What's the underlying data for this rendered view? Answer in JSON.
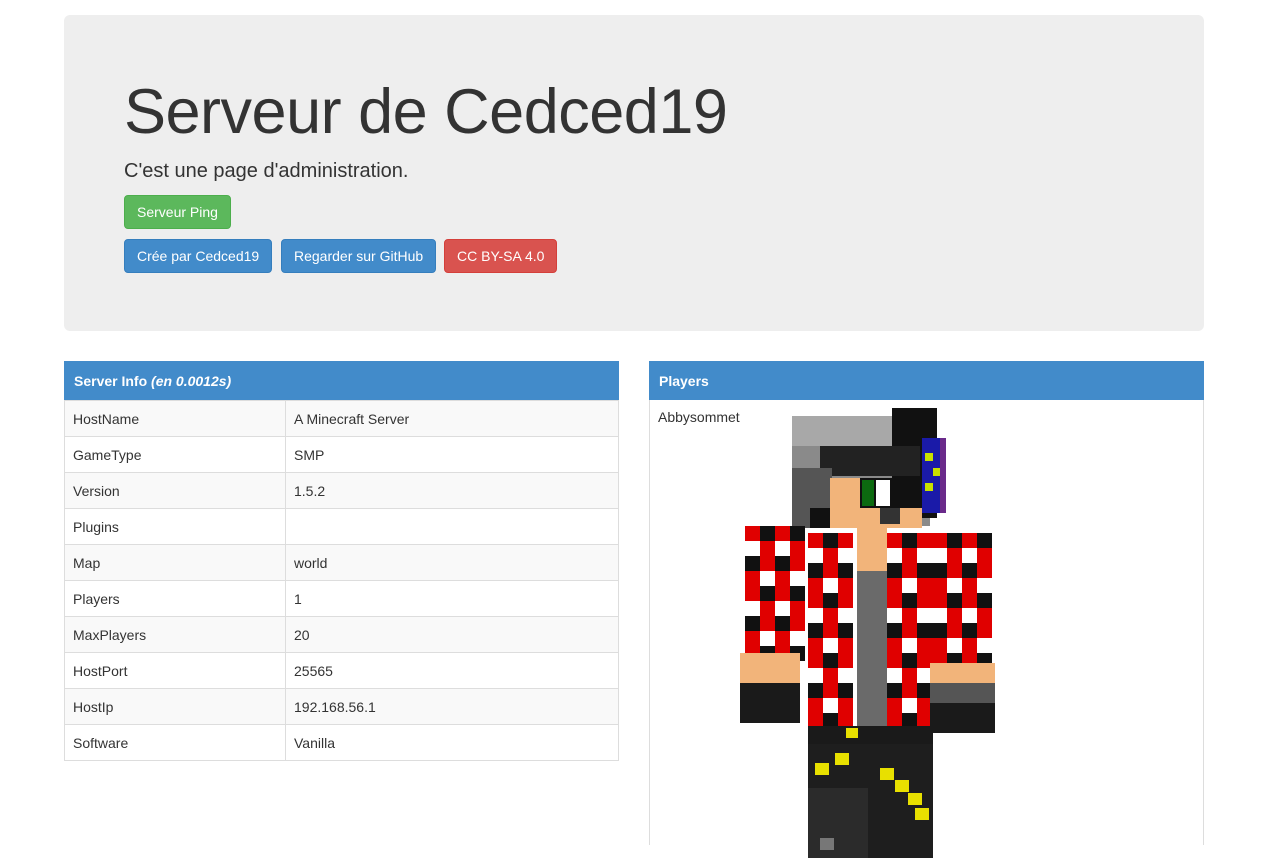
{
  "header": {
    "title": "Serveur de Cedced19",
    "subtitle": "C'est une page d'administration.",
    "ping_button": "Serveur Ping",
    "links": [
      {
        "label": "Crée par Cedced19",
        "color": "#428bca"
      },
      {
        "label": "Regarder sur GitHub",
        "color": "#428bca"
      },
      {
        "label": "CC BY-SA 4.0",
        "color": "#d9534f"
      }
    ]
  },
  "server_info": {
    "title": "Server Info",
    "timing": "(en 0.0012s)",
    "rows": [
      {
        "key": "HostName",
        "value": "A Minecraft Server"
      },
      {
        "key": "GameType",
        "value": "SMP"
      },
      {
        "key": "Version",
        "value": "1.5.2"
      },
      {
        "key": "Plugins",
        "value": ""
      },
      {
        "key": "Map",
        "value": "world"
      },
      {
        "key": "Players",
        "value": "1"
      },
      {
        "key": "MaxPlayers",
        "value": "20"
      },
      {
        "key": "HostPort",
        "value": "25565"
      },
      {
        "key": "HostIp",
        "value": "192.168.56.1"
      },
      {
        "key": "Software",
        "value": "Vanilla"
      }
    ]
  },
  "players": {
    "title": "Players",
    "list": [
      {
        "name": "Abbysommet",
        "skin": "player-skin-image"
      }
    ]
  },
  "colors": {
    "accent": "#428bca",
    "success": "#5cb85c",
    "danger": "#d9534f",
    "jumbotron_bg": "#eeeeee"
  }
}
